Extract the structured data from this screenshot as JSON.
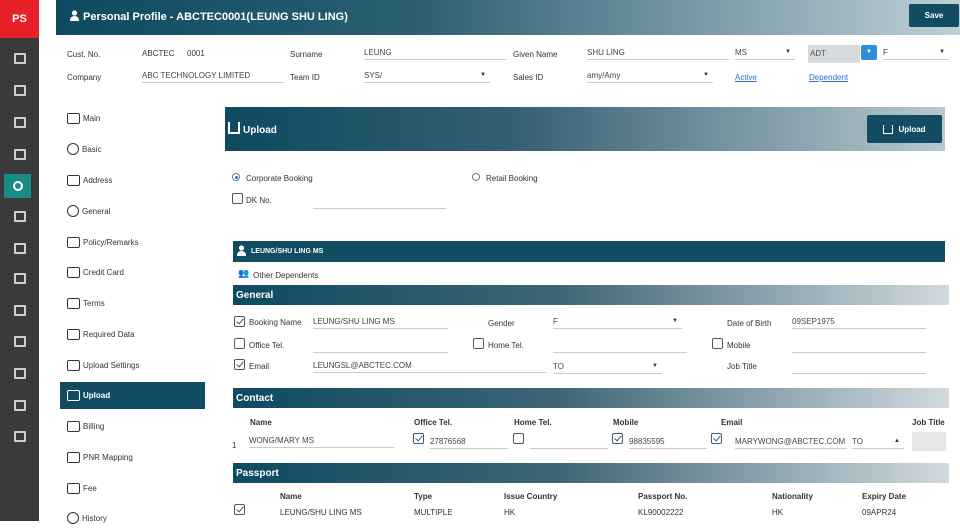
{
  "app": {
    "logo": "PS",
    "title": "Personal Profile - ABCTEC0001(LEUNG SHU LING)",
    "save_label": "Save"
  },
  "rail_icons": [
    "dashboard-icon",
    "notes-icon",
    "list-icon",
    "document-icon",
    "users-icon",
    "briefcase-icon",
    "settings-doc-icon",
    "table-icon",
    "window-icon",
    "calc-doc-icon",
    "list-lines-icon",
    "report-icon",
    "export-icon"
  ],
  "header": {
    "cust_no_label": "Cust. No.",
    "cust_prefix": "ABCTEC",
    "cust_number": "0001",
    "surname_label": "Surname",
    "surname": "LEUNG",
    "given_label": "Given Name",
    "given": "SHU LING",
    "title": "MS",
    "pax_type": "ADT",
    "gender": "F",
    "company_label": "Company",
    "company": "ABC TECHNOLOGY LIMITED",
    "team_label": "Team ID",
    "team": "SYS/",
    "sales_label": "Sales ID",
    "sales": "amy/Amy",
    "active_link": "Active",
    "dependent_link": "Dependent"
  },
  "sidebar": [
    {
      "label": "Main",
      "icon": "id-card-icon"
    },
    {
      "label": "Basic",
      "icon": "info-icon"
    },
    {
      "label": "Address",
      "icon": "address-icon"
    },
    {
      "label": "General",
      "icon": "info-icon"
    },
    {
      "label": "Policy/Remarks",
      "icon": "policy-icon"
    },
    {
      "label": "Credit Card",
      "icon": "credit-card-icon"
    },
    {
      "label": "Terms",
      "icon": "terms-icon"
    },
    {
      "label": "Required Data",
      "icon": "terminal-icon"
    },
    {
      "label": "Upload Settings",
      "icon": "upload-icon"
    },
    {
      "label": "Upload",
      "icon": "upload-icon"
    },
    {
      "label": "Billing",
      "icon": "billing-icon"
    },
    {
      "label": "PNR Mapping",
      "icon": "pnr-icon"
    },
    {
      "label": "Fee",
      "icon": "tag-icon"
    },
    {
      "label": "History",
      "icon": "history-icon"
    }
  ],
  "upload": {
    "title": "Upload",
    "button": "Upload",
    "corporate": "Corporate Booking",
    "retail": "Retail Booking",
    "dk": "DK No.",
    "pax_name": "LEUNG/SHU LING MS",
    "other_dependents": "Other Dependents"
  },
  "general": {
    "section": "General",
    "booking_name_label": "Booking Name",
    "booking_name": "LEUNG/SHU LING MS",
    "gender_label": "Gender",
    "gender": "F",
    "dob_label": "Date of Birth",
    "dob": "09SEP1975",
    "office_label": "Office Tel.",
    "home_label": "Home Tel.",
    "mobile_label": "Mobile",
    "email_label": "Email",
    "email": "LEUNGSL@ABCTEC.COM",
    "email_to": "TO",
    "job_label": "Job Title"
  },
  "contact": {
    "section": "Contact",
    "headers": [
      "Name",
      "Office Tel.",
      "Home Tel.",
      "Mobile",
      "Email",
      "Job Title"
    ],
    "row": {
      "index": "1",
      "name": "WONG/MARY MS",
      "office": "27876568",
      "home": "",
      "mobile": "98835595",
      "email": "MARYWONG@ABCTEC.COM",
      "email_to": "TO"
    }
  },
  "passport": {
    "section": "Passport",
    "headers": [
      "Name",
      "Type",
      "Issue Country",
      "Passport No.",
      "Nationality",
      "Expiry Date"
    ],
    "row": {
      "name": "LEUNG/SHU LING MS",
      "type": "MULTIPLE",
      "country": "HK",
      "number": "KL90002222",
      "nationality": "HK",
      "expiry": "09APR24"
    }
  },
  "colors": {
    "brand_red": "#e8202a",
    "accent_teal": "#114c62",
    "active_rail": "#1a8a86",
    "link_blue": "#2a6fd1"
  }
}
